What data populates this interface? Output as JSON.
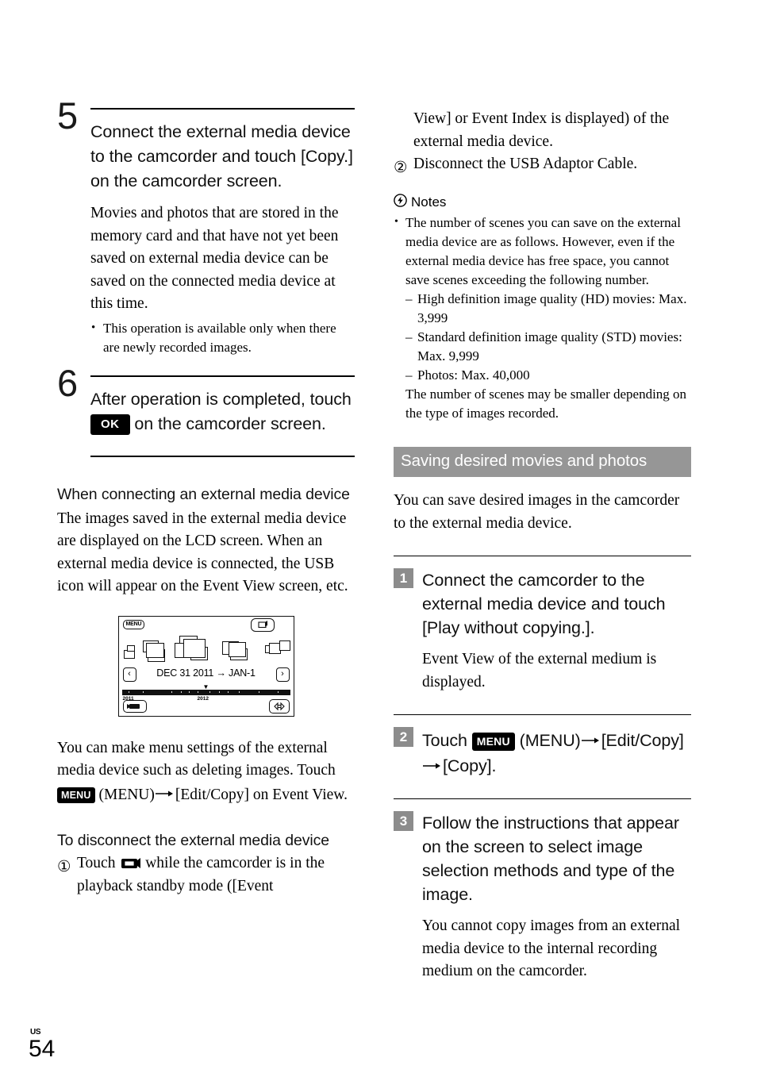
{
  "document": {
    "page_number": "54",
    "region_code": "US"
  },
  "left_column": {
    "step5": {
      "number": "5",
      "heading": "Connect the external media device to the camcorder and touch [Copy.] on the camcorder screen.",
      "paragraph": "Movies and photos that are stored in the memory card and that have not yet been saved on external media device can be saved on the connected media device at this time.",
      "bullets": [
        "This operation is available only when there are newly recorded images."
      ]
    },
    "step6": {
      "number": "6",
      "heading_before": "After operation is completed, touch",
      "ok_badge": "OK",
      "heading_after": "on the camcorder screen."
    },
    "connecting_section": {
      "heading": "When connecting an external media device",
      "paragraph": "The images saved in the external media device are displayed on the LCD screen. When an external media device is connected, the USB icon will appear on the Event View screen, etc."
    },
    "lcd_screen": {
      "menu_label": "MENU",
      "date_range": "DEC 31 2011 → JAN-1",
      "nav_prev": "‹",
      "nav_next": "›",
      "year_start": "2011",
      "year_end": "2012",
      "marker": "▼"
    },
    "menu_settings": {
      "text_before": "You can make menu settings of the external media device such as deleting images. Touch",
      "menu_badge": "MENU",
      "text_after": "(MENU)",
      "arrow": "→",
      "text_end": "[Edit/Copy] on Event View."
    },
    "disconnect_section": {
      "heading": "To disconnect the external media device",
      "items": [
        {
          "marker": "①",
          "text_before": "Touch",
          "icon": "camcorder-icon",
          "text_after": "while the camcorder is in the playback standby mode ([Event"
        }
      ]
    }
  },
  "right_column": {
    "continuation": {
      "text": "View] or Event Index is displayed) of the external media device.",
      "item2_marker": "②",
      "item2_text": "Disconnect the USB Adaptor Cable."
    },
    "notes": {
      "icon": "notes-lightning-icon",
      "title": "Notes",
      "bullets": [
        "The number of scenes you can save on the external media device are as follows. However, even if the external media device has free space, you cannot save scenes exceeding the following number."
      ],
      "dash_items": [
        "High definition image quality (HD) movies: Max. 3,999",
        "Standard definition image quality (STD) movies: Max. 9,999",
        "Photos: Max. 40,000"
      ],
      "tail": "The number of scenes may be smaller depending on the type of images recorded."
    },
    "section_header": "Saving desired movies and photos",
    "section_intro": "You can save desired images in the camcorder to the external media device.",
    "steps": [
      {
        "number": "1",
        "heading": "Connect the camcorder to the external media device and touch [Play without copying.].",
        "paragraph": "Event View of the external medium is displayed."
      },
      {
        "number": "2",
        "heading_before": "Touch",
        "menu_badge": "MENU",
        "heading_mid": "(MENU)",
        "arrow": "→",
        "heading_after": "[Edit/Copy]",
        "arrow2": "→",
        "heading_end": "[Copy].",
        "paragraph": ""
      },
      {
        "number": "3",
        "heading": "Follow the instructions that appear on the screen to select image selection methods and type of the image.",
        "paragraph": "You cannot copy images from an external media device to the internal recording medium on the camcorder."
      }
    ]
  },
  "colors": {
    "section_bar": "#969696",
    "step_square": "#8c8c8c",
    "badge": "#000000",
    "text": "#000000"
  }
}
